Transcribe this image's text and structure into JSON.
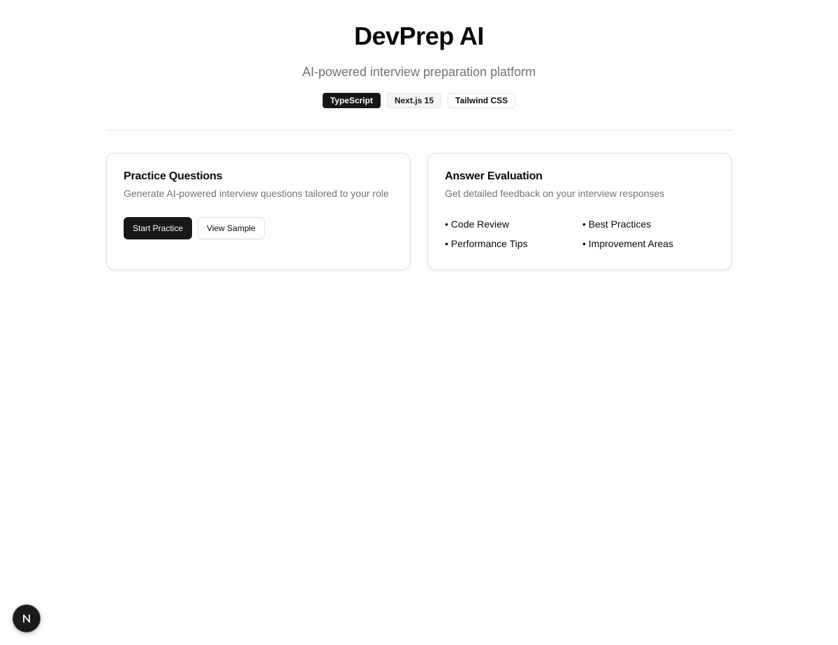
{
  "header": {
    "title": "DevPrep AI",
    "subtitle": "AI-powered interview preparation platform"
  },
  "badges": [
    "TypeScript",
    "Next.js 15",
    "Tailwind CSS"
  ],
  "cards": {
    "practice": {
      "title": "Practice Questions",
      "description": "Generate AI-powered interview questions tailored to your role",
      "primary_button": "Start Practice",
      "secondary_button": "View Sample"
    },
    "evaluation": {
      "title": "Answer Evaluation",
      "description": "Get detailed feedback on your interview responses",
      "features": [
        "Code Review",
        "Best Practices",
        "Performance Tips",
        "Improvement Areas"
      ]
    }
  },
  "dev_indicator": {
    "icon": "nextjs-logo-icon",
    "letter": "N"
  },
  "colors": {
    "primary": "#171717",
    "muted_text": "#737373",
    "border": "#e5e5e5",
    "background": "#ffffff"
  }
}
